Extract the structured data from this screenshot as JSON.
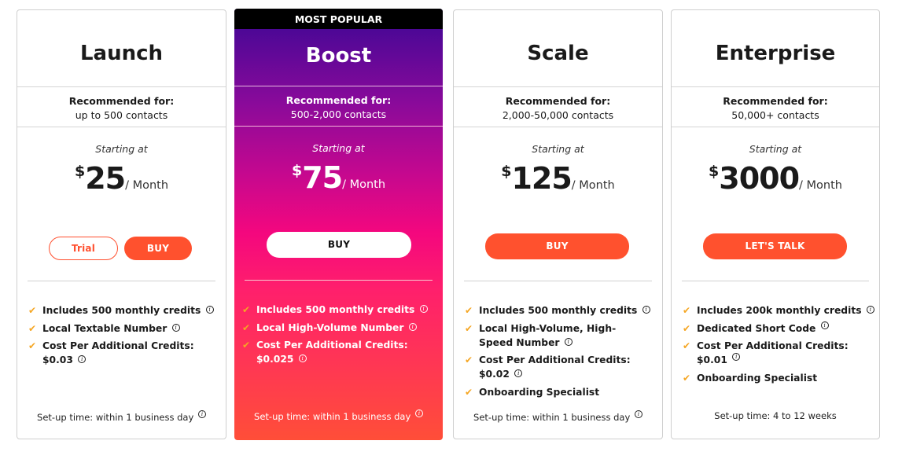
{
  "colors": {
    "accent": "#ff512e",
    "check": "#f5a623",
    "popular_gradient_top": "#4a0796",
    "popular_gradient_mid": "#f4077e",
    "popular_gradient_bottom": "#ff4e38",
    "badge_bg": "#000000"
  },
  "plans": [
    {
      "name": "Launch",
      "recommended_label": "Recommended for:",
      "recommended_value": "up to 500 contacts",
      "starting_label": "Starting at",
      "currency": "$",
      "price": "25",
      "period": "/ Month",
      "buttons": {
        "trial": "Trial",
        "buy": "BUY"
      },
      "features": [
        {
          "text": "Includes 500 monthly credits",
          "info_icon": "info-icon"
        },
        {
          "text": "Local Textable Number",
          "info_icon": "info-icon"
        },
        {
          "text": "Cost Per Additional Credits: $0.03",
          "info_icon": "info-icon"
        }
      ],
      "setup": "Set-up time: within 1 business day",
      "setup_info_icon": "info-icon"
    },
    {
      "badge": "MOST POPULAR",
      "name": "Boost",
      "recommended_label": "Recommended for:",
      "recommended_value": "500-2,000 contacts",
      "starting_label": "Starting at",
      "currency": "$",
      "price": "75",
      "period": "/ Month",
      "buttons": {
        "buy": "BUY"
      },
      "features": [
        {
          "text": "Includes 500 monthly credits",
          "info_icon": "info-icon"
        },
        {
          "text": "Local High-Volume Number",
          "info_icon": "info-icon"
        },
        {
          "text": "Cost Per Additional Credits: $0.025",
          "info_icon": "info-icon"
        }
      ],
      "setup": "Set-up time: within 1 business day",
      "setup_info_icon": "info-icon"
    },
    {
      "name": "Scale",
      "recommended_label": "Recommended for:",
      "recommended_value": "2,000-50,000 contacts",
      "starting_label": "Starting at",
      "currency": "$",
      "price": "125",
      "period": "/ Month",
      "buttons": {
        "buy": "BUY"
      },
      "features": [
        {
          "text": "Includes 500 monthly credits",
          "info_icon": "info-icon"
        },
        {
          "text": "Local High-Volume, High-Speed Number",
          "info_icon": "info-icon"
        },
        {
          "text": "Cost Per Additional Credits: $0.02",
          "info_icon": "info-icon"
        },
        {
          "text": "Onboarding Specialist"
        }
      ],
      "setup": "Set-up time: within 1 business day",
      "setup_info_icon": "info-icon"
    },
    {
      "name": "Enterprise",
      "recommended_label": "Recommended for:",
      "recommended_value": "50,000+ contacts",
      "starting_label": "Starting at",
      "currency": "$",
      "price": "3000",
      "period": "/ Month",
      "buttons": {
        "talk": "LET'S TALK"
      },
      "features": [
        {
          "text": "Includes 200k monthly credits",
          "info_icon": "info-icon"
        },
        {
          "text": "Dedicated Short Code",
          "info_icon": "info-icon"
        },
        {
          "text": "Cost Per Additional Credits: $0.01",
          "info_icon": "info-icon"
        },
        {
          "text": "Onboarding Specialist"
        }
      ],
      "setup": "Set-up time: 4 to 12 weeks"
    }
  ],
  "icons": {
    "check": "✔",
    "info": "i"
  }
}
